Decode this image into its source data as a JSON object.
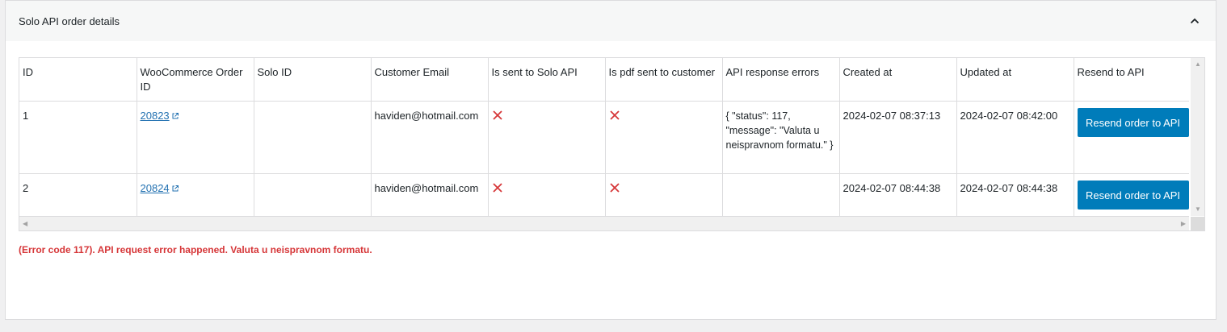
{
  "panel": {
    "title": "Solo API order details",
    "collapse_icon": "chevron-up-icon"
  },
  "table": {
    "headers": [
      "ID",
      "WooCommerce Order ID",
      "Solo ID",
      "Customer Email",
      "Is sent to Solo API",
      "Is pdf sent to customer",
      "API response errors",
      "Created at",
      "Updated at",
      "Resend to API"
    ],
    "rows": [
      {
        "id": "1",
        "woo_order_id": "20823",
        "solo_id": "",
        "email": "haviden@hotmail.com",
        "sent_to_api": "cross-icon",
        "pdf_sent": "cross-icon",
        "errors": "{ \"status\": 117, \"message\": \"Valuta u neispravnom formatu.\" }",
        "created_at": "2024-02-07 08:37:13",
        "updated_at": "2024-02-07 08:42:00",
        "button": "Resend order to API"
      },
      {
        "id": "2",
        "woo_order_id": "20824",
        "solo_id": "",
        "email": "haviden@hotmail.com",
        "sent_to_api": "cross-icon",
        "pdf_sent": "cross-icon",
        "errors": "",
        "created_at": "2024-02-07 08:44:38",
        "updated_at": "2024-02-07 08:44:38",
        "button": "Resend order to API"
      }
    ]
  },
  "error_message": "(Error code 117). API request error happened. Valuta u neispravnom formatu.",
  "colors": {
    "accent": "#007cba",
    "link": "#2271b1",
    "error": "#d63638"
  }
}
